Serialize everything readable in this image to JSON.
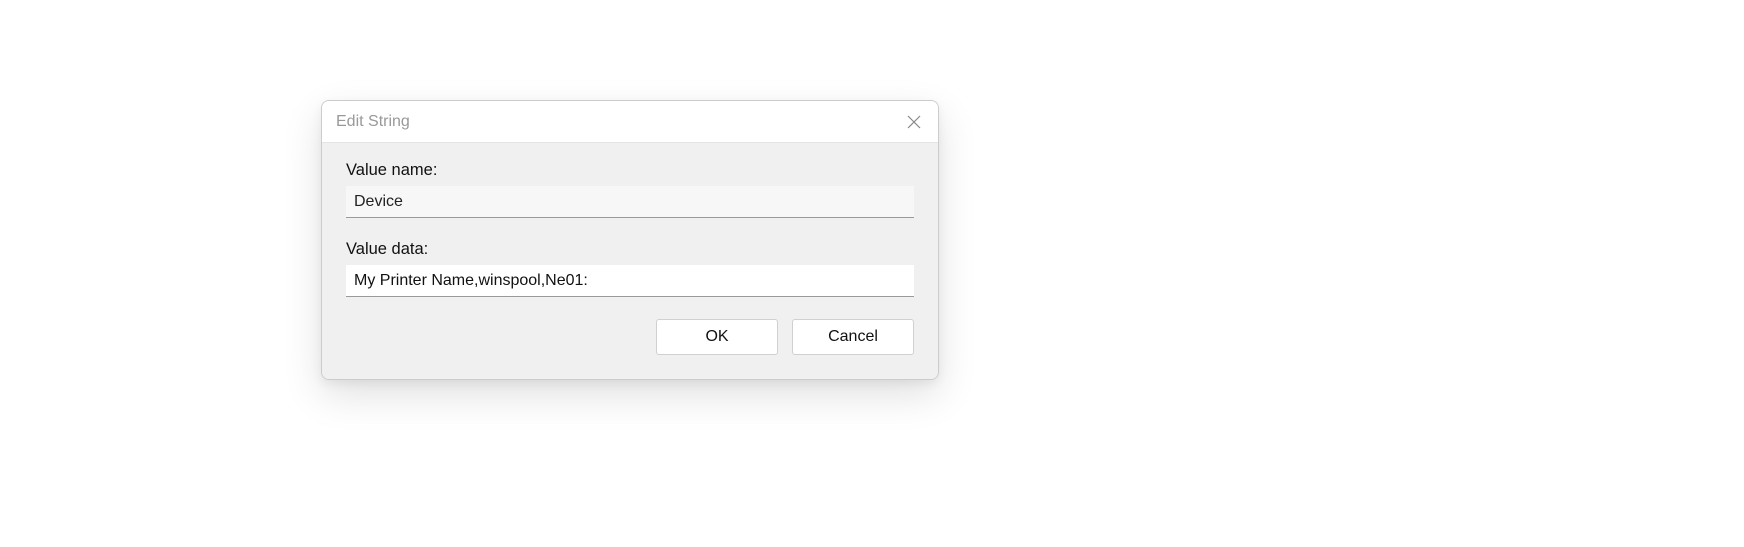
{
  "dialog": {
    "title": "Edit String",
    "value_name_label": "Value name:",
    "value_name": "Device",
    "value_data_label": "Value data:",
    "value_data": "My Printer Name,winspool,Ne01:",
    "ok_label": "OK",
    "cancel_label": "Cancel"
  }
}
